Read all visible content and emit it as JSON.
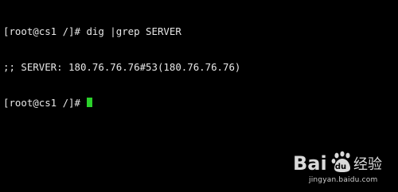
{
  "terminal": {
    "lines": [
      {
        "prompt": "[root@cs1 /]# ",
        "text": "dig |grep SERVER"
      },
      {
        "prompt": "",
        "text": ";; SERVER: 180.76.76.76#53(180.76.76.76)"
      },
      {
        "prompt": "[root@cs1 /]# ",
        "text": ""
      }
    ],
    "cursor_color": "#2bd12b",
    "text_color": "#e8e8e8",
    "background": "#000000"
  },
  "watermark": {
    "logo_text_left": "Bai",
    "logo_text_right": "经验",
    "url": "jingyan.baidu.com",
    "icon": "baidu-paw-icon"
  }
}
